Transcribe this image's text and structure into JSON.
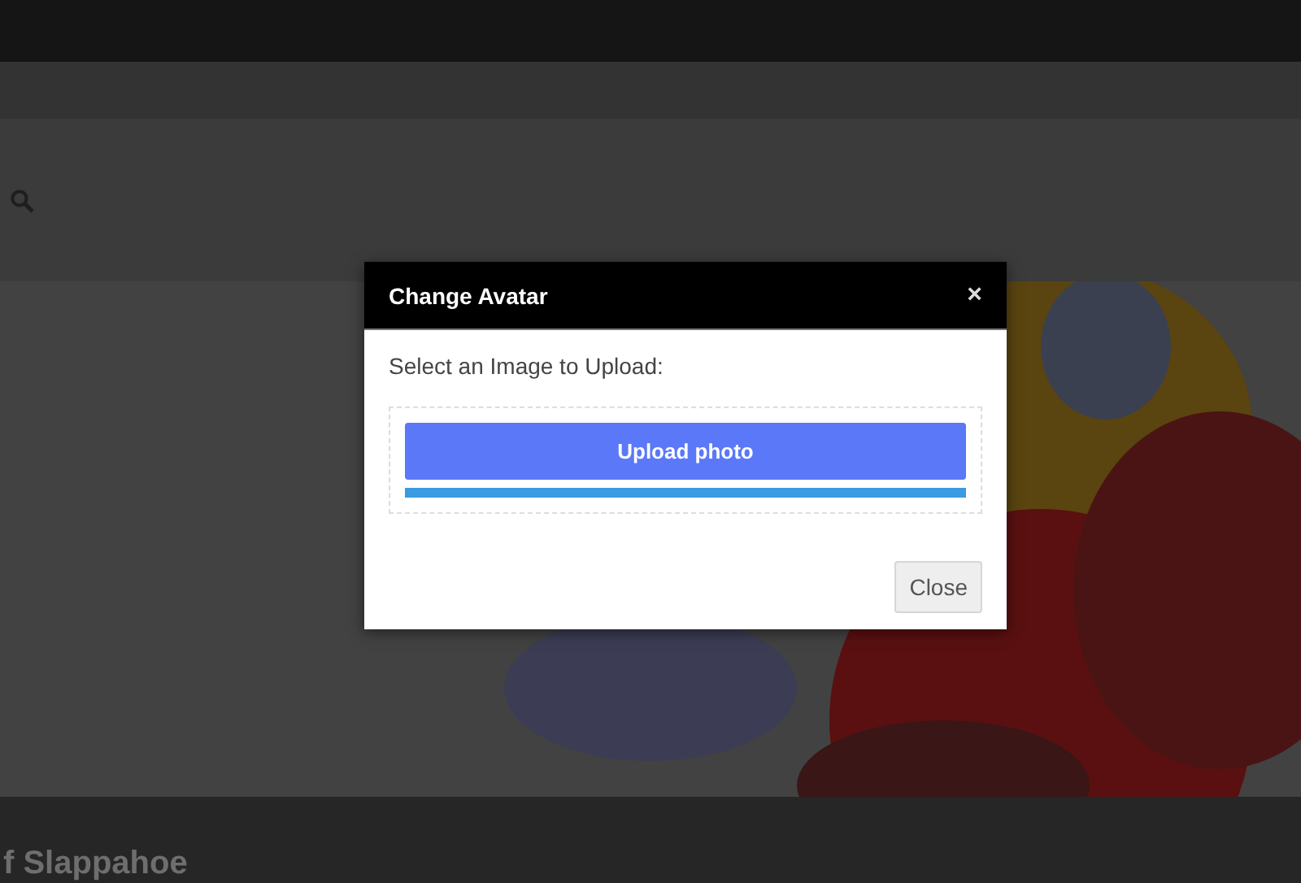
{
  "page": {
    "footer_heading": "f Slappahoe"
  },
  "dialog": {
    "title": "Change Avatar",
    "close_symbol": "×",
    "prompt": "Select an Image to Upload:",
    "upload_button": "Upload photo",
    "upload_progress": {
      "level": 1
    },
    "close_button": "Close"
  }
}
